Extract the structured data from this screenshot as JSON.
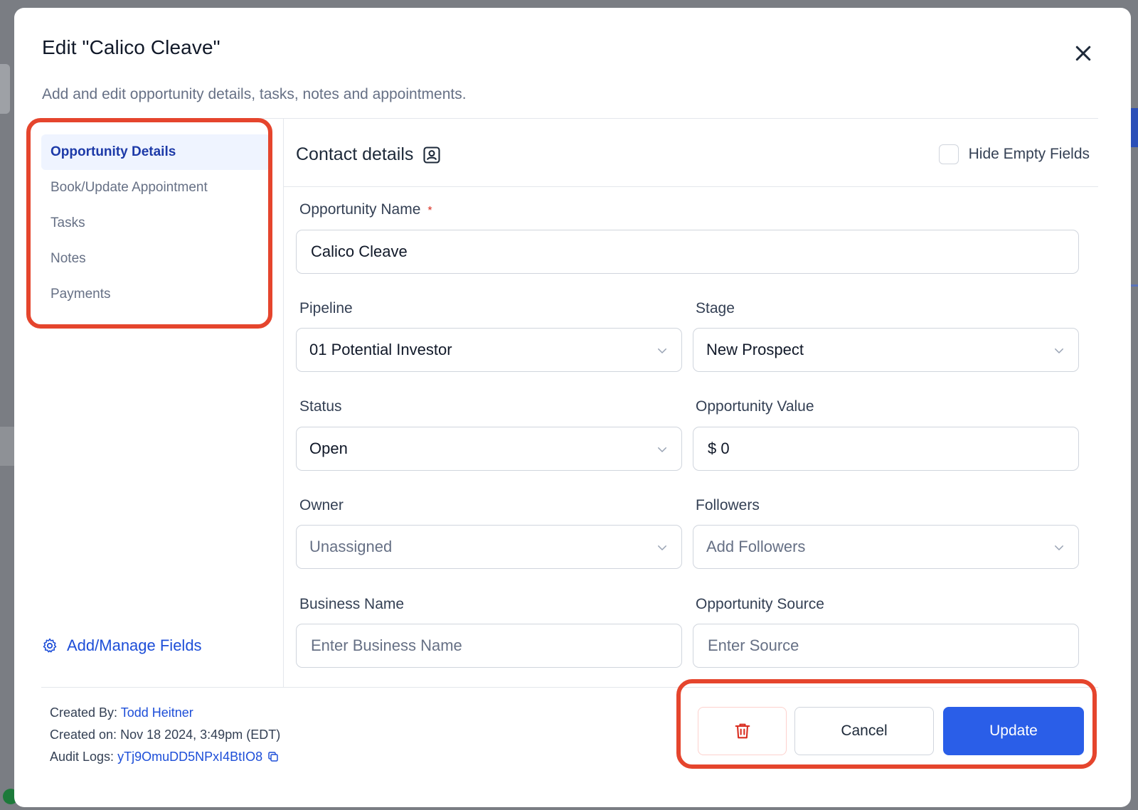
{
  "modal": {
    "title": "Edit \"Calico Cleave\"",
    "subtitle": "Add and edit opportunity details, tasks, notes and appointments."
  },
  "sidebar": {
    "items": [
      {
        "label": "Opportunity Details",
        "active": true
      },
      {
        "label": "Book/Update Appointment",
        "active": false
      },
      {
        "label": "Tasks",
        "active": false
      },
      {
        "label": "Notes",
        "active": false
      },
      {
        "label": "Payments",
        "active": false
      }
    ],
    "manage_label": "Add/Manage Fields"
  },
  "section": {
    "title": "Contact details",
    "hide_empty_label": "Hide Empty Fields"
  },
  "form": {
    "opportunity_name": {
      "label": "Opportunity Name",
      "required_mark": "*",
      "value": "Calico Cleave"
    },
    "pipeline": {
      "label": "Pipeline",
      "value": "01 Potential Investor"
    },
    "stage": {
      "label": "Stage",
      "value": "New Prospect"
    },
    "status": {
      "label": "Status",
      "value": "Open"
    },
    "opportunity_value": {
      "label": "Opportunity Value",
      "value": "$ 0"
    },
    "owner": {
      "label": "Owner",
      "placeholder": "Unassigned"
    },
    "followers": {
      "label": "Followers",
      "placeholder": "Add Followers"
    },
    "business_name": {
      "label": "Business Name",
      "placeholder": "Enter Business Name"
    },
    "opportunity_source": {
      "label": "Opportunity Source",
      "placeholder": "Enter Source"
    }
  },
  "meta": {
    "created_by_label": "Created By:",
    "created_by_value": "Todd Heitner",
    "created_on_label": "Created on:",
    "created_on_value": "Nov 18 2024, 3:49pm (EDT)",
    "audit_logs_label": "Audit Logs:",
    "audit_logs_value": "yTj9OmuDD5NPxI4BtIO8"
  },
  "actions": {
    "cancel_label": "Cancel",
    "update_label": "Update"
  },
  "colors": {
    "primary": "#2a5ee8",
    "annotation": "#e5452d",
    "danger": "#d92d20",
    "active_bg": "#eff4ff"
  }
}
